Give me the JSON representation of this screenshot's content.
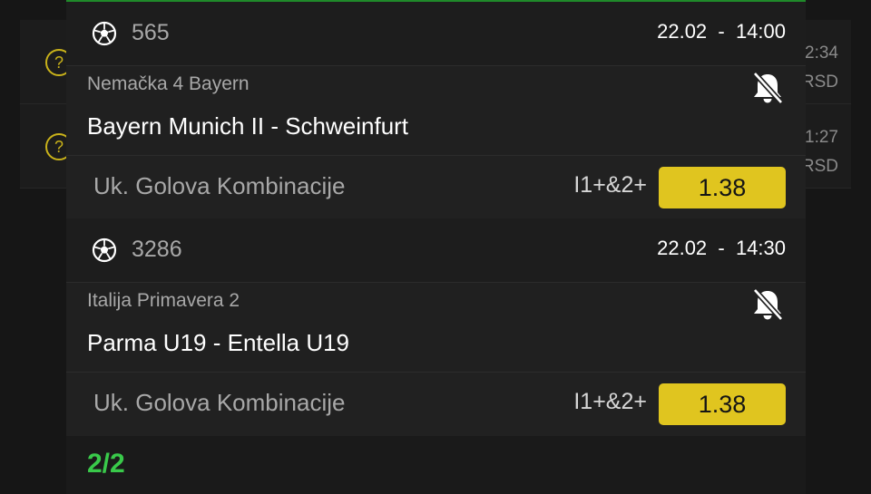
{
  "background_list": {
    "rows": [
      {
        "icon": "question-icon",
        "glyph": "?",
        "time": "2:34",
        "currency": "RSD"
      },
      {
        "icon": "question-icon",
        "glyph": "?",
        "time": "1:27",
        "currency": "RSD"
      }
    ]
  },
  "matches": [
    {
      "sport_icon": "soccer-ball-icon",
      "match_id": "565",
      "datetime": "22.02  -  14:00",
      "league": "Nemačka 4 Bayern",
      "teams": "Bayern Munich II - Schweinfurt",
      "notification_icon": "bell-off-icon",
      "bet_type": "Uk. Golova Kombinacije",
      "pick": "I1+&2+",
      "odd": "1.38"
    },
    {
      "sport_icon": "soccer-ball-icon",
      "match_id": "3286",
      "datetime": "22.02  -  14:30",
      "league": "Italija Primavera 2",
      "teams": "Parma U19 - Entella U19",
      "notification_icon": "bell-off-icon",
      "bet_type": "Uk. Golova Kombinacije",
      "pick": "I1+&2+",
      "odd": "1.38"
    }
  ],
  "footer": {
    "count": "2/2"
  },
  "colors": {
    "accent_green": "#1f8a2a",
    "count_green": "#39c94a",
    "odd_yellow": "#e0c51f",
    "background": "#202020"
  }
}
